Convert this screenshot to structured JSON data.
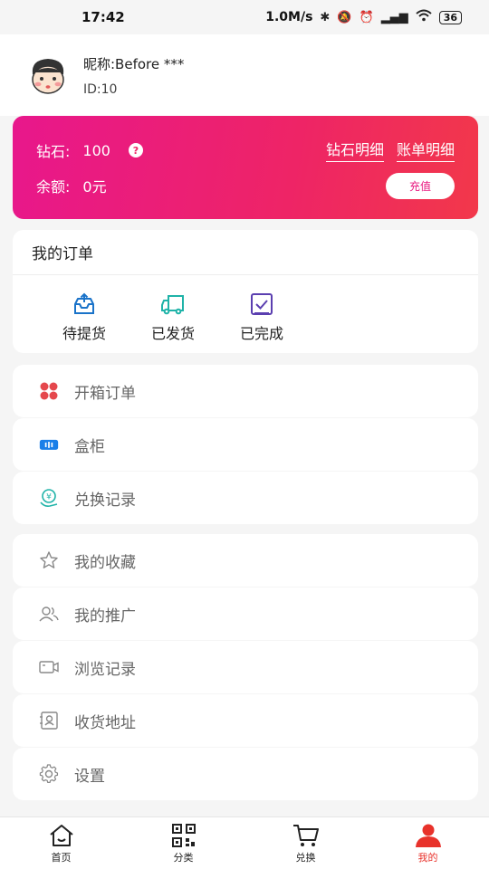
{
  "status": {
    "time": "17:42",
    "speed": "1.0M/s",
    "battery": "36"
  },
  "profile": {
    "nickname": "昵称:Before ***",
    "id": "ID:10"
  },
  "wallet": {
    "diamond_label": "钻石:",
    "diamond_value": "100",
    "balance_label": "余额:",
    "balance_value": "0元",
    "diamond_detail": "钻石明细",
    "bill_detail": "账单明细",
    "recharge": "充值",
    "help": "?"
  },
  "orders": {
    "title": "我的订单",
    "items": [
      {
        "label": "待提货",
        "icon": "pickup-icon"
      },
      {
        "label": "已发货",
        "icon": "truck-icon"
      },
      {
        "label": "已完成",
        "icon": "check-icon"
      }
    ]
  },
  "menu1": [
    {
      "label": "开箱订单",
      "icon": "box-order-icon"
    },
    {
      "label": "盒柜",
      "icon": "cabinet-icon"
    },
    {
      "label": "兑换记录",
      "icon": "exchange-icon"
    }
  ],
  "menu2": [
    {
      "label": "我的收藏",
      "icon": "star-icon"
    },
    {
      "label": "我的推广",
      "icon": "users-icon"
    },
    {
      "label": "浏览记录",
      "icon": "camera-icon"
    },
    {
      "label": "收货地址",
      "icon": "address-icon"
    },
    {
      "label": "设置",
      "icon": "gear-icon"
    }
  ],
  "tabs": [
    {
      "label": "首页",
      "icon": "home-icon"
    },
    {
      "label": "分类",
      "icon": "qr-icon"
    },
    {
      "label": "兑换",
      "icon": "cart-icon"
    },
    {
      "label": "我的",
      "icon": "user-icon"
    }
  ],
  "colors": {
    "accent": "#e8322b",
    "gradient_start": "#e8178c",
    "gradient_end": "#f2384a"
  }
}
